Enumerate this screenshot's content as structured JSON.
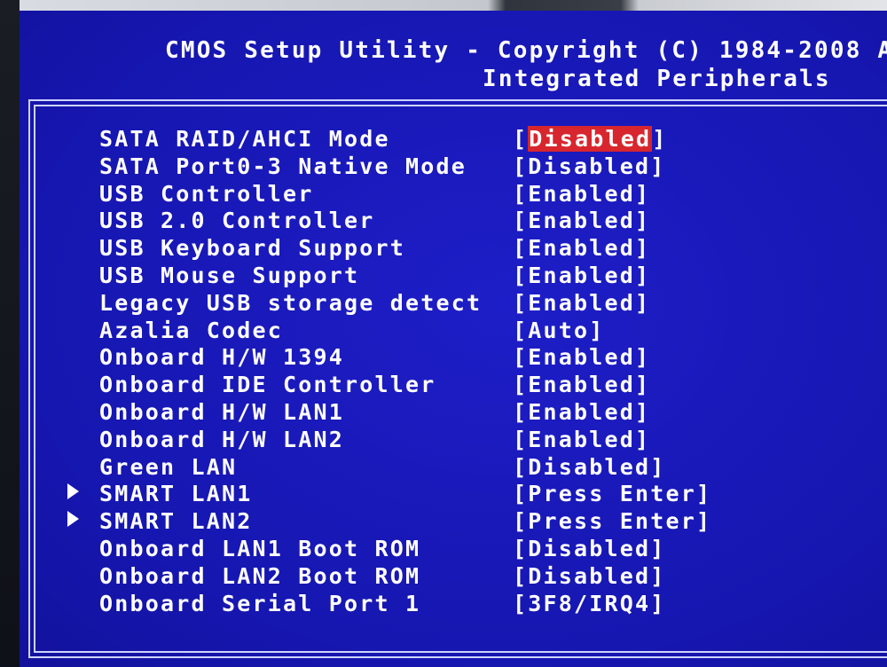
{
  "header": {
    "title": "CMOS Setup Utility - Copyright (C) 1984-2008 A",
    "subtitle": "Integrated Peripherals"
  },
  "colors": {
    "background": "#1818b4",
    "text": "#ffffff",
    "highlight": "#d7262e",
    "frame": "#cfd3ff"
  },
  "settings": [
    {
      "label": "SATA RAID/AHCI Mode",
      "value": "Disabled",
      "selected": true,
      "submenu": false
    },
    {
      "label": "SATA Port0-3 Native Mode",
      "value": "Disabled",
      "selected": false,
      "submenu": false
    },
    {
      "label": "USB Controller",
      "value": "Enabled",
      "selected": false,
      "submenu": false
    },
    {
      "label": "USB 2.0 Controller",
      "value": "Enabled",
      "selected": false,
      "submenu": false
    },
    {
      "label": "USB Keyboard Support",
      "value": "Enabled",
      "selected": false,
      "submenu": false
    },
    {
      "label": "USB Mouse Support",
      "value": "Enabled",
      "selected": false,
      "submenu": false
    },
    {
      "label": "Legacy USB storage detect",
      "value": "Enabled",
      "selected": false,
      "submenu": false
    },
    {
      "label": "Azalia Codec",
      "value": "Auto",
      "selected": false,
      "submenu": false
    },
    {
      "label": "Onboard H/W 1394",
      "value": "Enabled",
      "selected": false,
      "submenu": false
    },
    {
      "label": "Onboard IDE Controller",
      "value": "Enabled",
      "selected": false,
      "submenu": false
    },
    {
      "label": "Onboard H/W LAN1",
      "value": "Enabled",
      "selected": false,
      "submenu": false
    },
    {
      "label": "Onboard H/W LAN2",
      "value": "Enabled",
      "selected": false,
      "submenu": false
    },
    {
      "label": "Green LAN",
      "value": "Disabled",
      "selected": false,
      "submenu": false
    },
    {
      "label": "SMART LAN1",
      "value": "Press Enter",
      "selected": false,
      "submenu": true
    },
    {
      "label": "SMART LAN2",
      "value": "Press Enter",
      "selected": false,
      "submenu": true
    },
    {
      "label": "Onboard LAN1 Boot ROM",
      "value": "Disabled",
      "selected": false,
      "submenu": false
    },
    {
      "label": "Onboard LAN2 Boot ROM",
      "value": "Disabled",
      "selected": false,
      "submenu": false
    },
    {
      "label": "Onboard Serial Port 1",
      "value": "3F8/IRQ4",
      "selected": false,
      "submenu": false
    }
  ]
}
